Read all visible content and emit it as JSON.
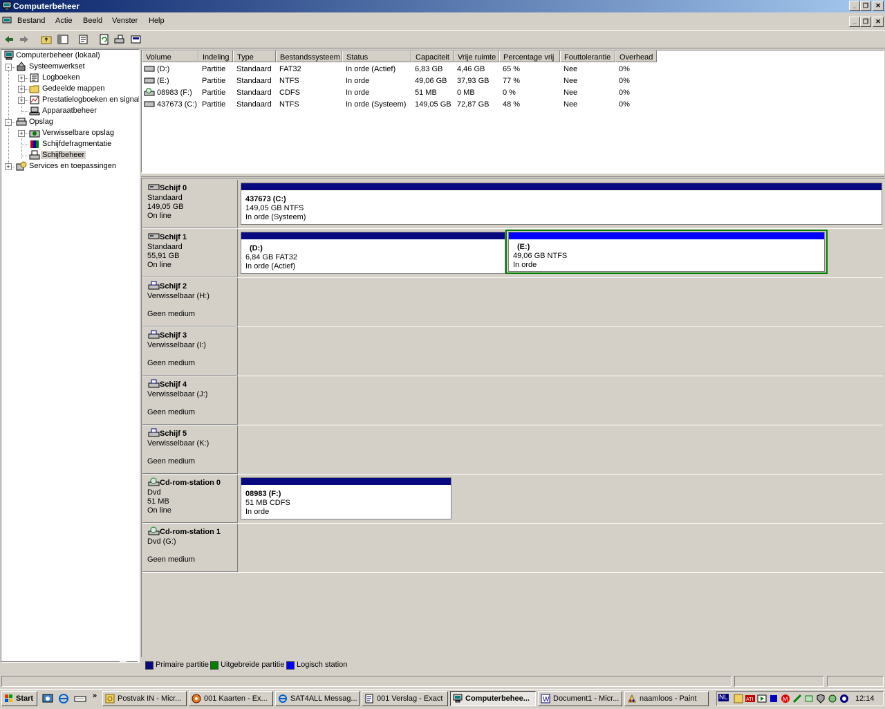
{
  "window": {
    "title": "Computerbeheer"
  },
  "menu": [
    "Bestand",
    "Actie",
    "Beeld",
    "Venster",
    "Help"
  ],
  "tree": [
    {
      "label": "Computerbeheer (lokaal)",
      "level": 0,
      "expander": "",
      "icon": "computer-icon"
    },
    {
      "label": "Systeemwerkset",
      "level": 1,
      "expander": "-",
      "icon": "tools-icon"
    },
    {
      "label": "Logboeken",
      "level": 2,
      "expander": "+",
      "icon": "event-log-icon"
    },
    {
      "label": "Gedeelde mappen",
      "level": 2,
      "expander": "+",
      "icon": "folder-icon"
    },
    {
      "label": "Prestatielogboeken en signal",
      "level": 2,
      "expander": "+",
      "icon": "performance-icon"
    },
    {
      "label": "Apparaatbeheer",
      "level": 2,
      "expander": "",
      "icon": "device-manager-icon"
    },
    {
      "label": "Opslag",
      "level": 1,
      "expander": "-",
      "icon": "storage-icon"
    },
    {
      "label": "Verwisselbare opslag",
      "level": 2,
      "expander": "+",
      "icon": "removable-storage-icon"
    },
    {
      "label": "Schijfdefragmentatie",
      "level": 2,
      "expander": "",
      "icon": "defrag-icon"
    },
    {
      "label": "Schijfbeheer",
      "level": 2,
      "expander": "",
      "icon": "disk-management-icon",
      "selected": true
    },
    {
      "label": "Services en toepassingen",
      "level": 1,
      "expander": "+",
      "icon": "services-icon"
    }
  ],
  "volume_table": {
    "columns": [
      "Volume",
      "Indeling",
      "Type",
      "Bestandssysteem",
      "Status",
      "Capaciteit",
      "Vrije ruimte",
      "Percentage vrij",
      "Fouttolerantie",
      "Overhead"
    ],
    "rows": [
      [
        "(D:)",
        "Partitie",
        "Standaard",
        "FAT32",
        "In orde (Actief)",
        "6,83 GB",
        "4,46 GB",
        "65 %",
        "Nee",
        "0%"
      ],
      [
        "(E:)",
        "Partitie",
        "Standaard",
        "NTFS",
        "In orde",
        "49,06 GB",
        "37,93 GB",
        "77 %",
        "Nee",
        "0%"
      ],
      [
        "08983 (F:)",
        "Partitie",
        "Standaard",
        "CDFS",
        "In orde",
        "51 MB",
        "0 MB",
        "0 %",
        "Nee",
        "0%"
      ],
      [
        "437673 (C:)",
        "Partitie",
        "Standaard",
        "NTFS",
        "In orde (Systeem)",
        "149,05 GB",
        "72,87 GB",
        "48 %",
        "Nee",
        "0%"
      ]
    ]
  },
  "disks": [
    {
      "name": "Schijf 0",
      "lines": [
        "Standaard",
        "149,05 GB",
        "On line"
      ],
      "icon": "hard-disk-icon",
      "partitions": [
        {
          "name": "437673  (C:)",
          "size": "149,05 GB NTFS",
          "status": "In orde (Systeem)",
          "kind": "primary"
        }
      ]
    },
    {
      "name": "Schijf 1",
      "lines": [
        "Standaard",
        "55,91 GB",
        "On line"
      ],
      "icon": "hard-disk-icon",
      "partitions": [
        {
          "name": "(D:)",
          "size": "6,84 GB FAT32",
          "status": "In orde (Actief)",
          "kind": "primary"
        },
        {
          "name": "(E:)",
          "size": "49,06 GB NTFS",
          "status": "In orde",
          "kind": "logical"
        }
      ]
    },
    {
      "name": "Schijf 2",
      "lines": [
        "Verwisselbaar (H:)",
        "",
        "Geen medium"
      ],
      "icon": "removable-disk-icon",
      "partitions": []
    },
    {
      "name": "Schijf 3",
      "lines": [
        "Verwisselbaar (I:)",
        "",
        "Geen medium"
      ],
      "icon": "removable-disk-icon",
      "partitions": []
    },
    {
      "name": "Schijf 4",
      "lines": [
        "Verwisselbaar (J:)",
        "",
        "Geen medium"
      ],
      "icon": "removable-disk-icon",
      "partitions": []
    },
    {
      "name": "Schijf 5",
      "lines": [
        "Verwisselbaar (K:)",
        "",
        "Geen medium"
      ],
      "icon": "removable-disk-icon",
      "partitions": []
    },
    {
      "name": "Cd-rom-station 0",
      "lines": [
        "Dvd",
        "51 MB",
        "On line"
      ],
      "icon": "cdrom-icon",
      "partitions": [
        {
          "name": "08983  (F:)",
          "size": "51 MB CDFS",
          "status": "In orde",
          "kind": "primary"
        }
      ]
    },
    {
      "name": "Cd-rom-station 1",
      "lines": [
        "Dvd (G:)",
        "",
        "Geen medium"
      ],
      "icon": "cdrom-icon",
      "partitions": []
    }
  ],
  "legend": [
    {
      "label": "Primaire partitie",
      "color": "#0a0a80"
    },
    {
      "label": "Uitgebreide partitie",
      "color": "#008000"
    },
    {
      "label": "Logisch station",
      "color": "#0000ff"
    }
  ],
  "taskbar": {
    "start": "Start",
    "tasks": [
      {
        "label": "Postvak IN - Micr...",
        "icon": "outlook-icon"
      },
      {
        "label": "001 Kaarten - Ex...",
        "icon": "exact-icon"
      },
      {
        "label": "SAT4ALL Messag...",
        "icon": "ie-icon"
      },
      {
        "label": "001 Verslag - Exact",
        "icon": "report-icon"
      },
      {
        "label": "Computerbehee...",
        "icon": "computer-icon",
        "active": true
      },
      {
        "label": "Document1 - Micr...",
        "icon": "word-icon"
      },
      {
        "label": "naamloos - Paint",
        "icon": "paint-icon"
      }
    ],
    "lang": "NL",
    "clock": "12:14"
  },
  "colors": {
    "primary": "#0a0a80",
    "extended": "#008000",
    "logical": "#0000ff",
    "title_start": "#0a246a",
    "title_end": "#a6caf0"
  }
}
